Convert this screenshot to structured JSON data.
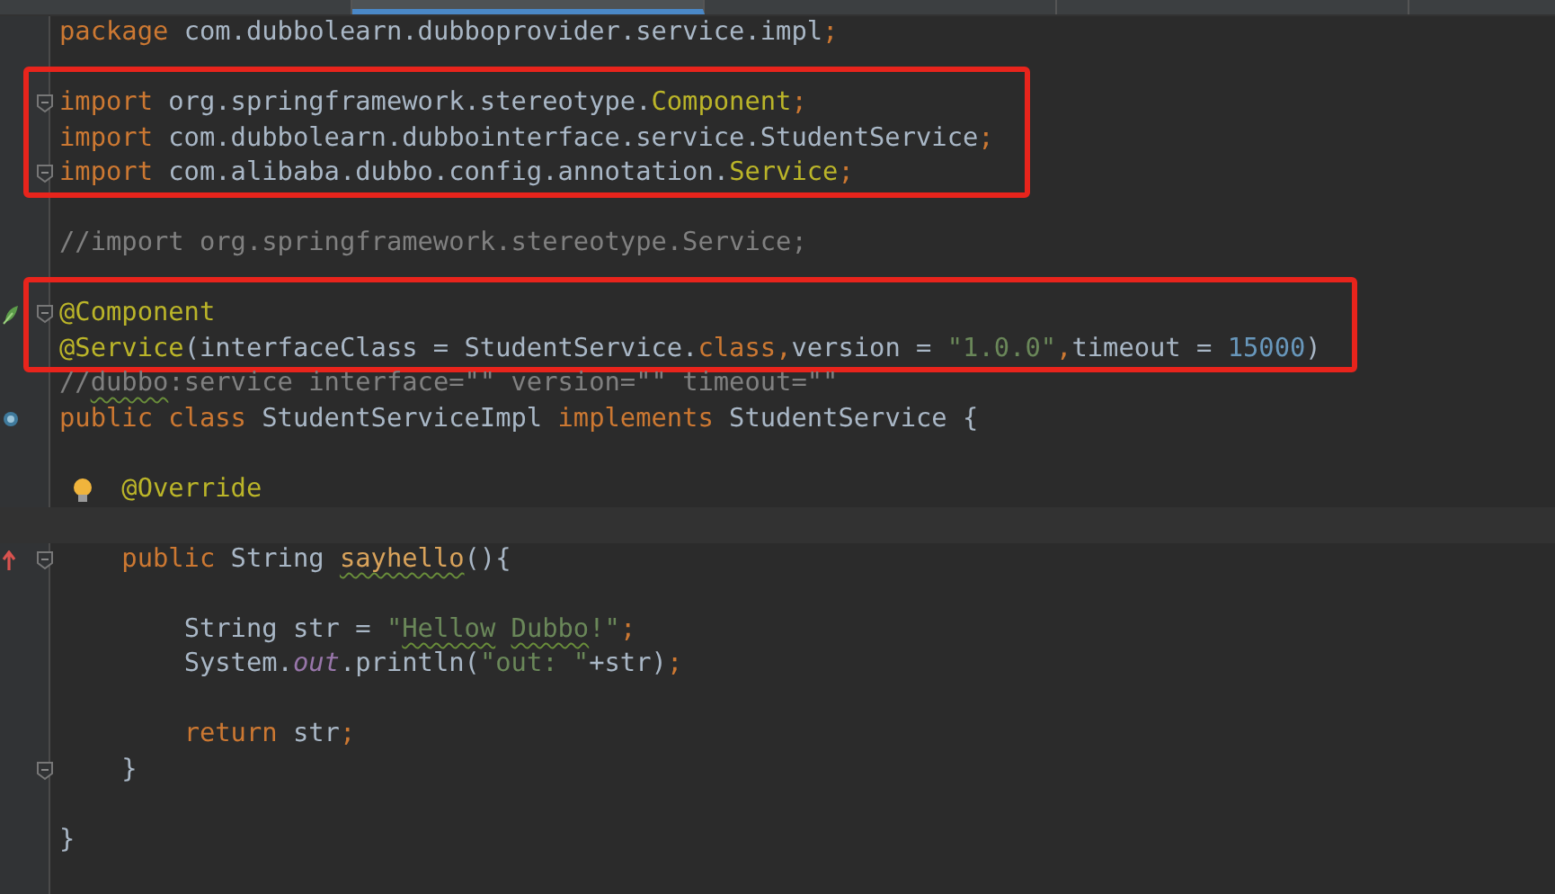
{
  "tabs": [
    {
      "selected": false
    },
    {
      "selected": true
    },
    {
      "selected": false
    },
    {
      "selected": false
    }
  ],
  "lines": [
    {
      "kind": "code",
      "tokens": [
        {
          "text": "package",
          "kind": "keyword"
        },
        {
          "text": " com.dubbolearn.dubboprovider.service.impl",
          "kind": "plain"
        },
        {
          "text": ";",
          "kind": "keyword"
        }
      ]
    },
    {
      "kind": "blank"
    },
    {
      "kind": "code",
      "boxed": true,
      "fold": true,
      "tokens": [
        {
          "text": "import",
          "kind": "keyword"
        },
        {
          "text": " org.springframework.stereotype.",
          "kind": "plain"
        },
        {
          "text": "Component",
          "kind": "annotation"
        },
        {
          "text": ";",
          "kind": "keyword"
        }
      ]
    },
    {
      "kind": "code",
      "boxed": true,
      "tokens": [
        {
          "text": "import",
          "kind": "keyword"
        },
        {
          "text": " com.dubbolearn.dubbointerface.service.StudentService",
          "kind": "plain"
        },
        {
          "text": ";",
          "kind": "keyword"
        }
      ]
    },
    {
      "kind": "code",
      "boxed": true,
      "fold": true,
      "tokens": [
        {
          "text": "import",
          "kind": "keyword"
        },
        {
          "text": " com.alibaba.dubbo.config.annotation.",
          "kind": "plain"
        },
        {
          "text": "Service",
          "kind": "annotation"
        },
        {
          "text": ";",
          "kind": "keyword"
        }
      ]
    },
    {
      "kind": "blank"
    },
    {
      "kind": "code",
      "tokens": [
        {
          "text": "//import org.springframework.stereotype.Service;",
          "kind": "comment"
        }
      ]
    },
    {
      "kind": "blank"
    },
    {
      "kind": "code",
      "boxed": true,
      "fold": true,
      "marker": {
        "kind": "bean"
      },
      "tokens": [
        {
          "text": "@Component",
          "kind": "annotation"
        }
      ]
    },
    {
      "kind": "code",
      "boxed": true,
      "tokens": [
        {
          "text": "@Service",
          "kind": "annotation"
        },
        {
          "text": "(interfaceClass = StudentService.",
          "kind": "plain"
        },
        {
          "text": "class",
          "kind": "keyword"
        },
        {
          "text": ",",
          "kind": "keyword"
        },
        {
          "text": "version = ",
          "kind": "plain"
        },
        {
          "text": "\"1.0.0\"",
          "kind": "string"
        },
        {
          "text": ",",
          "kind": "keyword"
        },
        {
          "text": "timeout = ",
          "kind": "plain"
        },
        {
          "text": "15000",
          "kind": "number"
        },
        {
          "text": ")",
          "kind": "plain"
        }
      ]
    },
    {
      "kind": "code",
      "tokens": [
        {
          "text": "//",
          "kind": "comment"
        },
        {
          "text": "dubbo",
          "kind": "comment",
          "typo": true
        },
        {
          "text": ":service interface=\"\" version=\"\" timeout=\"\"",
          "kind": "comment"
        }
      ]
    },
    {
      "kind": "code",
      "marker": {
        "kind": "class"
      },
      "tokens": [
        {
          "text": "public class",
          "kind": "keyword"
        },
        {
          "text": " StudentServiceImpl ",
          "kind": "plain"
        },
        {
          "text": "implements",
          "kind": "keyword"
        },
        {
          "text": " StudentService {",
          "kind": "plain"
        }
      ]
    },
    {
      "kind": "blank"
    },
    {
      "kind": "code",
      "bulb": true,
      "tokens": [
        {
          "text": "    @Override",
          "kind": "annotation"
        }
      ]
    },
    {
      "kind": "blank",
      "current": true
    },
    {
      "kind": "code",
      "fold": true,
      "marker": {
        "kind": "override"
      },
      "tokens": [
        {
          "text": "    public",
          "kind": "keyword"
        },
        {
          "text": " String ",
          "kind": "plain"
        },
        {
          "text": "sayhello",
          "kind": "method",
          "typo": true
        },
        {
          "text": "(){",
          "kind": "plain"
        }
      ]
    },
    {
      "kind": "blank"
    },
    {
      "kind": "code",
      "tokens": [
        {
          "text": "        String str = ",
          "kind": "plain"
        },
        {
          "text": "\"",
          "kind": "string"
        },
        {
          "text": "Hellow",
          "kind": "string",
          "typo": true
        },
        {
          "text": " Dubbo",
          "kind": "string",
          "typo": true
        },
        {
          "text": "!\"",
          "kind": "string"
        },
        {
          "text": ";",
          "kind": "keyword"
        }
      ]
    },
    {
      "kind": "code",
      "tokens": [
        {
          "text": "        System.",
          "kind": "plain"
        },
        {
          "text": "out",
          "kind": "field"
        },
        {
          "text": ".println(",
          "kind": "plain"
        },
        {
          "text": "\"out: \"",
          "kind": "string"
        },
        {
          "text": "+str)",
          "kind": "plain"
        },
        {
          "text": ";",
          "kind": "keyword"
        }
      ]
    },
    {
      "kind": "blank"
    },
    {
      "kind": "code",
      "tokens": [
        {
          "text": "        return",
          "kind": "keyword"
        },
        {
          "text": " str",
          "kind": "plain"
        },
        {
          "text": ";",
          "kind": "keyword"
        }
      ]
    },
    {
      "kind": "code",
      "fold": true,
      "tokens": [
        {
          "text": "    }",
          "kind": "plain"
        }
      ]
    },
    {
      "kind": "blank"
    },
    {
      "kind": "code",
      "tokens": [
        {
          "text": "}",
          "kind": "plain"
        }
      ]
    }
  ]
}
